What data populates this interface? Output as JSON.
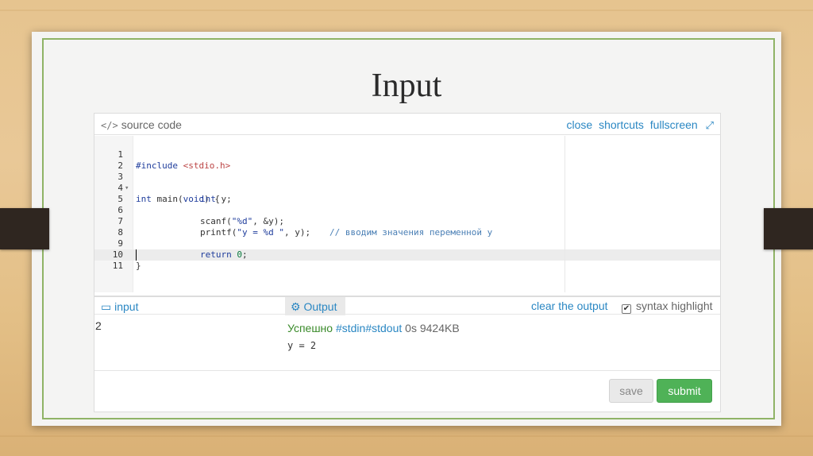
{
  "slide": {
    "title": "Input"
  },
  "editor": {
    "header_label": "source code",
    "header_icon": "code-icon",
    "links": [
      "close",
      "shortcuts",
      "fullscreen"
    ],
    "fullscreen_icon": "expand-icon",
    "line_numbers": [
      "1",
      "2",
      "3",
      "4",
      "5",
      "6",
      "7",
      "8",
      "9",
      "10",
      "11"
    ],
    "lines": {
      "l1_a": "#include ",
      "l1_b": "<stdio.h>",
      "l3_a": "int",
      "l3_b": " main(",
      "l3_c": "void",
      "l3_d": ") {",
      "l4_a": "int",
      "l4_b": " y;",
      "l6_a": "scanf(",
      "l6_b": "\"%d\"",
      "l6_c": ", &y);",
      "l6_cmt": "// вводим значения переменной y",
      "l7_a": "printf(",
      "l7_b": "\"y = %d \"",
      "l7_c": ", y);",
      "l9_a": "return",
      "l9_b": "0",
      "l9_c": ";",
      "l10": "}"
    }
  },
  "io": {
    "input_tab": "input",
    "input_icon": "inbox-icon",
    "output_tab": "Output",
    "output_icon": "gears-icon",
    "clear_output": "clear the output",
    "syntax_highlight": "syntax highlight",
    "syntax_checked": true,
    "input_value": "2",
    "status_success": "Успешно",
    "status_stdin": "#stdin",
    "status_stdout": "#stdout",
    "status_time": "0s",
    "status_memory": "9424KB",
    "result": "y = 2"
  },
  "buttons": {
    "save": "save",
    "submit": "submit"
  },
  "colors": {
    "accent": "#2a87c3",
    "success": "#4fb257",
    "frame": "#8fb366"
  }
}
